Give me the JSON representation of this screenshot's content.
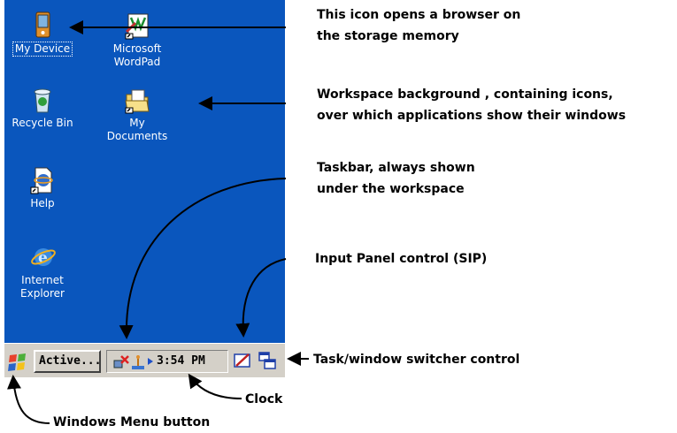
{
  "desktop": {
    "icons": [
      {
        "label": "My Device",
        "icon": "pda-device-icon"
      },
      {
        "label": "Microsoft\nWordPad",
        "icon": "wordpad-icon"
      },
      {
        "label": "Recycle Bin",
        "icon": "recycle-bin-icon"
      },
      {
        "label": "My\nDocuments",
        "icon": "folder-icon"
      },
      {
        "label": "Help",
        "icon": "help-icon"
      },
      {
        "label": "Internet\nExplorer",
        "icon": "internet-explorer-icon"
      }
    ],
    "background_color": "#0a56bd"
  },
  "taskbar": {
    "start_icon": "windows-flag-icon",
    "active_button": "Active...",
    "tray_icons": [
      "network-disconnected-icon",
      "usb-connection-icon",
      "arrow-right-icon"
    ],
    "clock": "3:54 PM",
    "sip_icon": "input-panel-icon",
    "switcher_icon": "task-switcher-icon"
  },
  "annotations": {
    "device_line1": "This icon opens a browser on",
    "device_line2": "the storage memory",
    "workspace_line1": "Workspace background , containing icons,",
    "workspace_line2": "over which applications show their windows",
    "taskbar_line1": "Taskbar, always shown",
    "taskbar_line2": "under the workspace",
    "sip": "Input Panel control (SIP)",
    "switcher": "Task/window switcher control",
    "clock": "Clock",
    "start": "Windows Menu button"
  }
}
